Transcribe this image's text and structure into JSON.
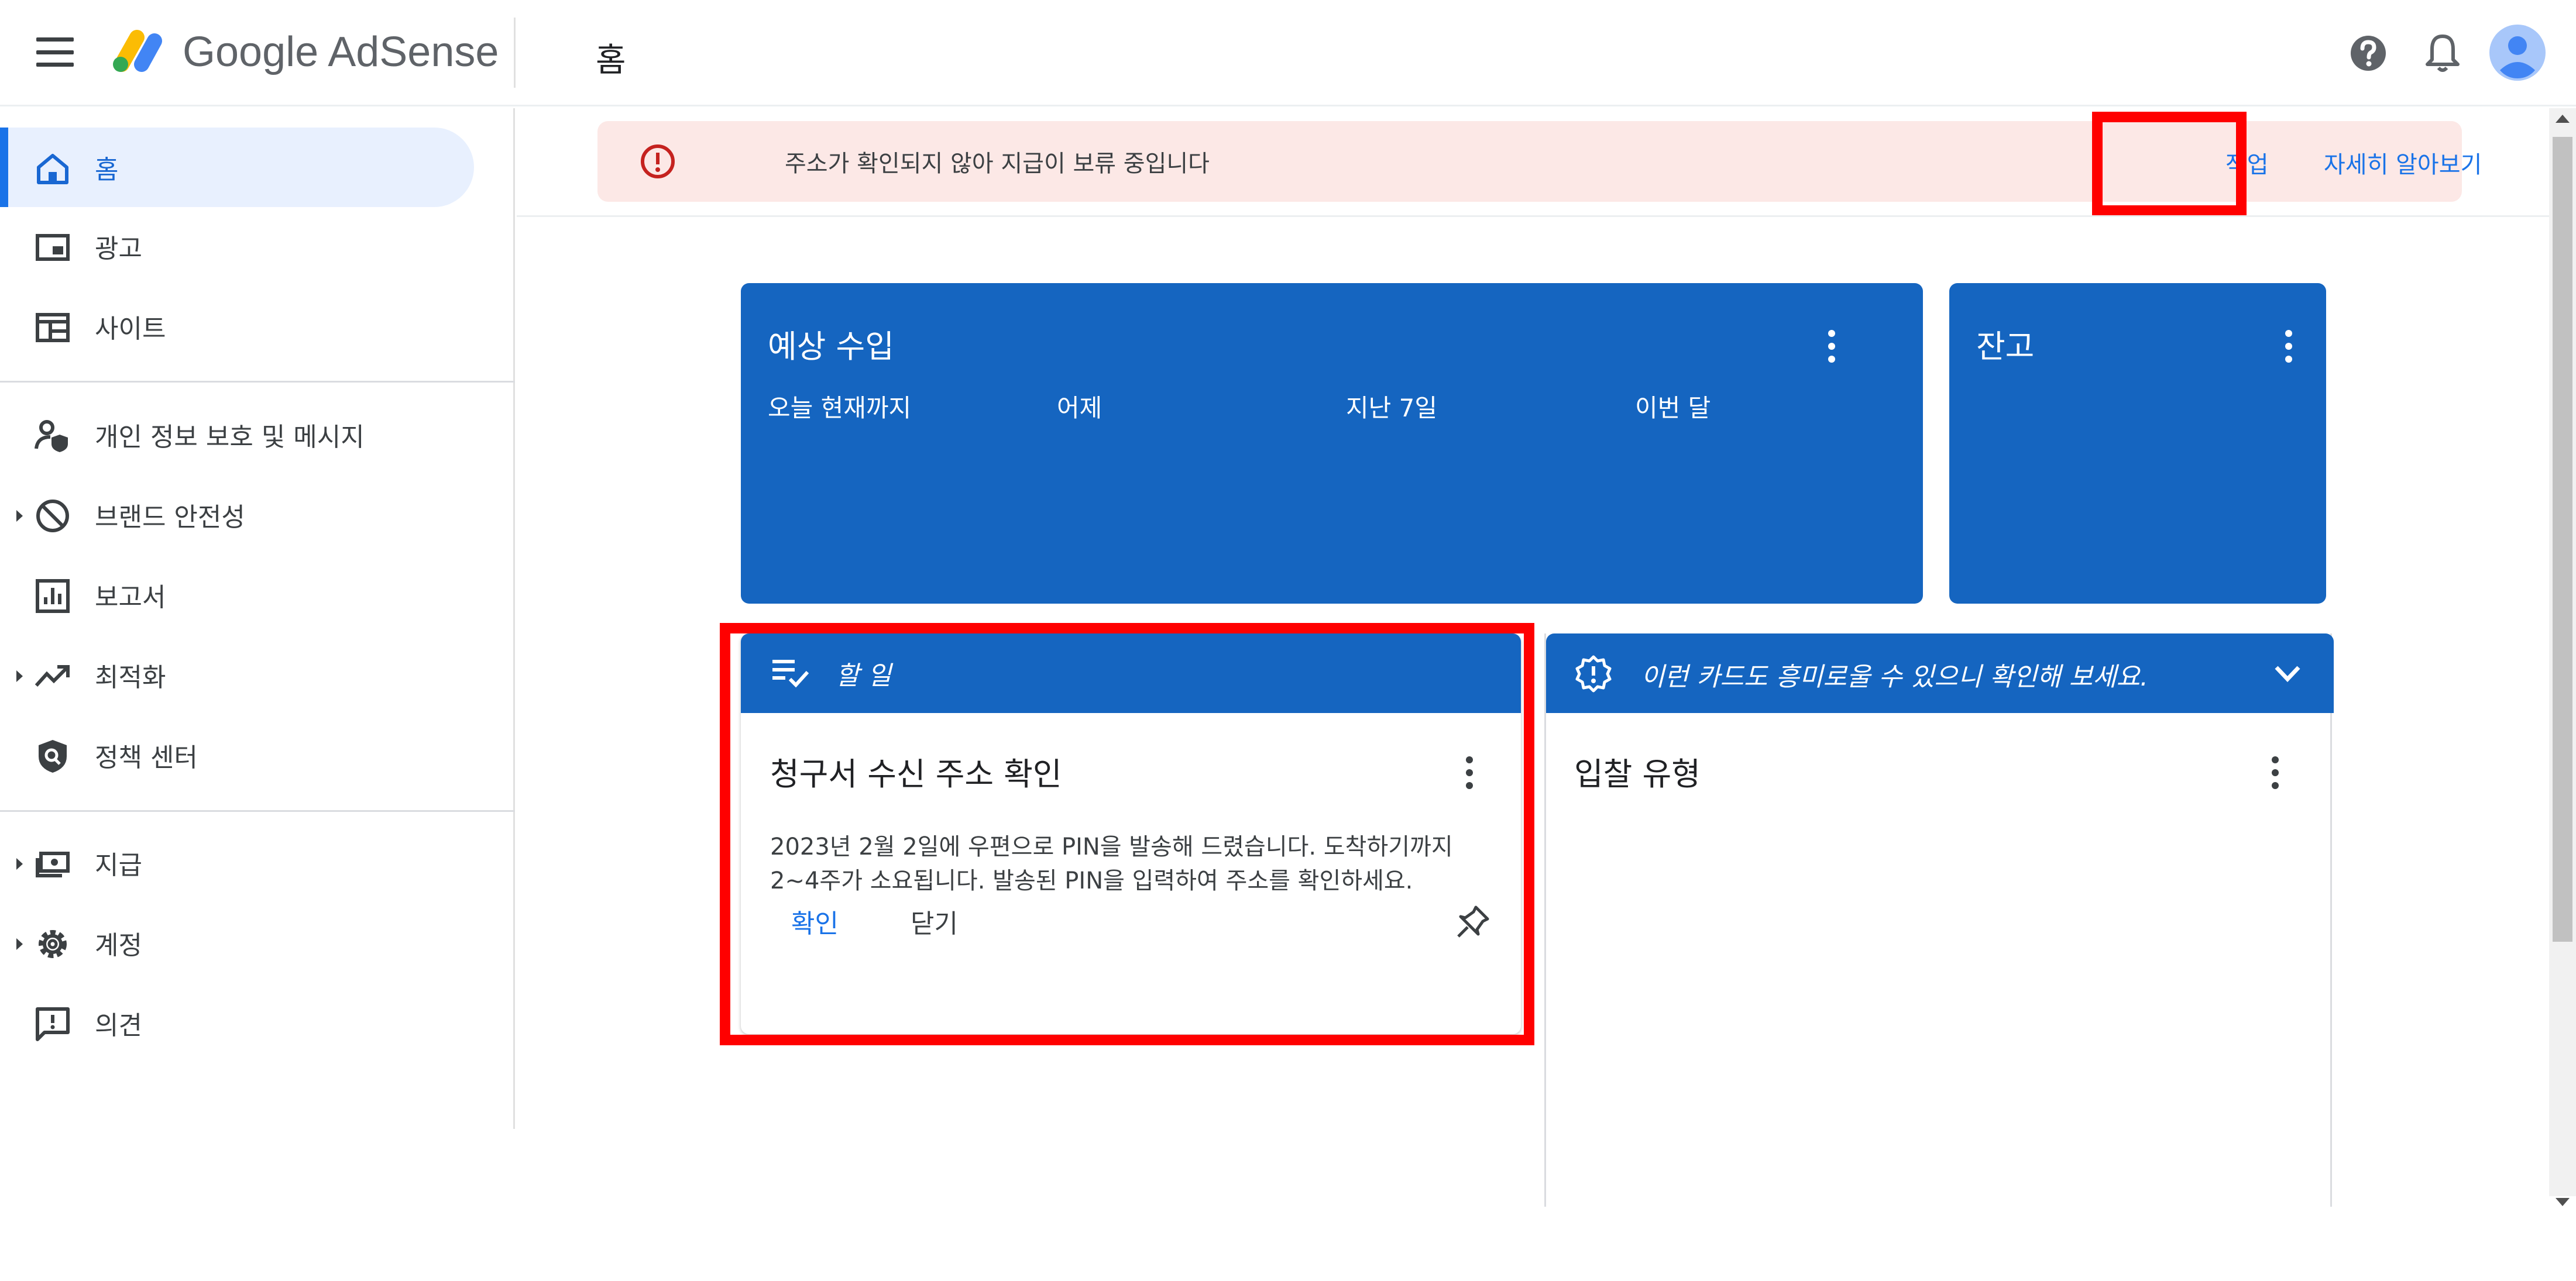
{
  "app": {
    "brand": "Google AdSense",
    "page_title": "홈"
  },
  "sidebar": {
    "items": [
      {
        "label": "홈",
        "icon": "home-icon",
        "active": true,
        "expandable": false
      },
      {
        "label": "광고",
        "icon": "ads-icon",
        "active": false,
        "expandable": false
      },
      {
        "label": "사이트",
        "icon": "sites-icon",
        "active": false,
        "expandable": false
      },
      {
        "label": "개인 정보 보호 및 메시지",
        "icon": "privacy-icon",
        "active": false,
        "expandable": false
      },
      {
        "label": "브랜드 안전성",
        "icon": "block-icon",
        "active": false,
        "expandable": true
      },
      {
        "label": "보고서",
        "icon": "reports-icon",
        "active": false,
        "expandable": false
      },
      {
        "label": "최적화",
        "icon": "trending-icon",
        "active": false,
        "expandable": true
      },
      {
        "label": "정책 센터",
        "icon": "policy-icon",
        "active": false,
        "expandable": false
      },
      {
        "label": "지급",
        "icon": "payments-icon",
        "active": false,
        "expandable": true
      },
      {
        "label": "계정",
        "icon": "gear-icon",
        "active": false,
        "expandable": true
      },
      {
        "label": "의견",
        "icon": "feedback-icon",
        "active": false,
        "expandable": false
      }
    ]
  },
  "alert": {
    "text": "주소가 확인되지 않아 지급이 보류 중입니다",
    "action_label": "작업",
    "learn_more_label": "자세히 알아보기"
  },
  "earnings_card": {
    "title": "예상 수입",
    "columns": [
      "오늘 현재까지",
      "어제",
      "지난 7일",
      "이번 달"
    ]
  },
  "balance_card": {
    "title": "잔고"
  },
  "todo_card": {
    "header": "할 일",
    "title": "청구서 수신 주소 확인",
    "body": "2023년 2월 2일에 우편으로 PIN을 발송해 드렸습니다. 도착하기까지 2~4주가 소요됩니다. 발송된 PIN을 입력하여 주소를 확인하세요.",
    "confirm_label": "확인",
    "close_label": "닫기"
  },
  "suggest_card": {
    "header": "이런 카드도 흥미로울 수 있으니 확인해 보세요.",
    "title": "입찰 유형"
  },
  "colors": {
    "card_blue": "#1565c0",
    "link_blue": "#1a73e8",
    "alert_bg": "#fce8e6",
    "alert_red": "#c5221f",
    "highlight_red": "#ff0000",
    "nav_active_bg": "#e8f0fe"
  }
}
